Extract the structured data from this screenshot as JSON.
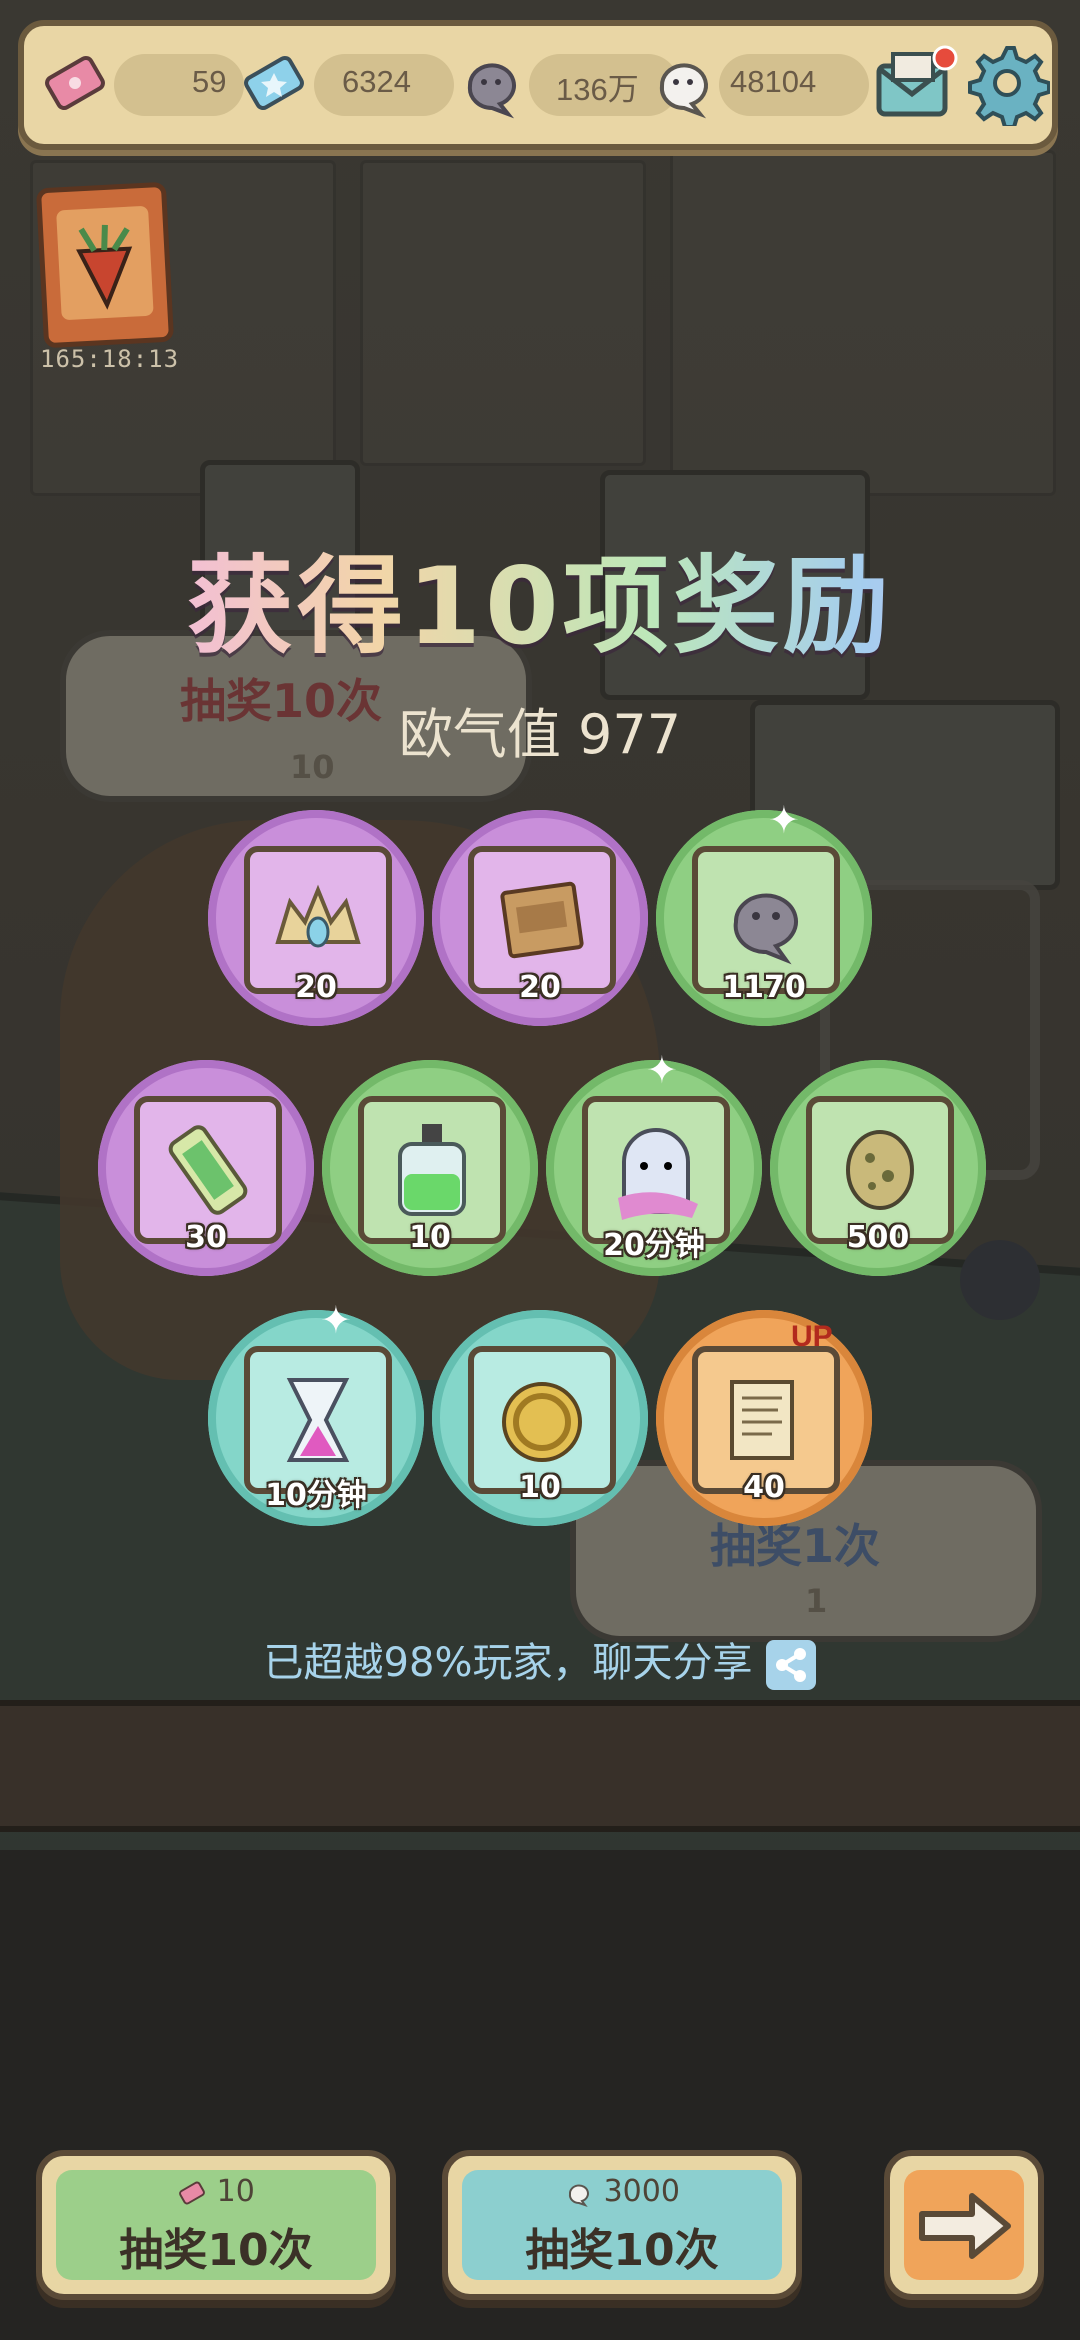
{
  "status_bar": {
    "tickets": "59",
    "blue_tickets": "6324",
    "grey_spirits": "136万",
    "white_spirits": "48104"
  },
  "event": {
    "timer": "165:18:13"
  },
  "background_buttons": {
    "draw10_label": "抽奖10次",
    "draw10_cost": "10",
    "draw1_label": "抽奖1次",
    "draw1_cost": "1"
  },
  "result": {
    "title": "获得10项奖励",
    "luck_value": "欧气值 977",
    "rewards": [
      {
        "qty": "20",
        "rarity": "purple",
        "icon": "crown-icon"
      },
      {
        "qty": "20",
        "rarity": "purple",
        "icon": "plaque-icon"
      },
      {
        "qty": "1170",
        "rarity": "green",
        "icon": "spirit-icon"
      },
      {
        "qty": "30",
        "rarity": "purple",
        "icon": "scroll-tube-icon"
      },
      {
        "qty": "10",
        "rarity": "green",
        "icon": "potion-icon"
      },
      {
        "qty": "20分钟",
        "rarity": "green",
        "icon": "ghost-icon"
      },
      {
        "qty": "500",
        "rarity": "green",
        "icon": "virus-icon"
      },
      {
        "qty": "10分钟",
        "rarity": "teal",
        "icon": "hourglass-icon"
      },
      {
        "qty": "10",
        "rarity": "teal",
        "icon": "coin-icon"
      },
      {
        "qty": "40",
        "rarity": "orange",
        "icon": "parchment-icon",
        "badge": "UP"
      }
    ],
    "share_text": "已超越98%玩家，聊天分享"
  },
  "bottom_buttons": {
    "ticket_draw": {
      "cost": "10",
      "label": "抽奖10次"
    },
    "spirit_draw": {
      "cost": "3000",
      "label": "抽奖10次"
    }
  },
  "colors": {
    "purple": "#c98fda",
    "green": "#8fcf83",
    "teal": "#84d6c9",
    "orange": "#f0a45a"
  }
}
